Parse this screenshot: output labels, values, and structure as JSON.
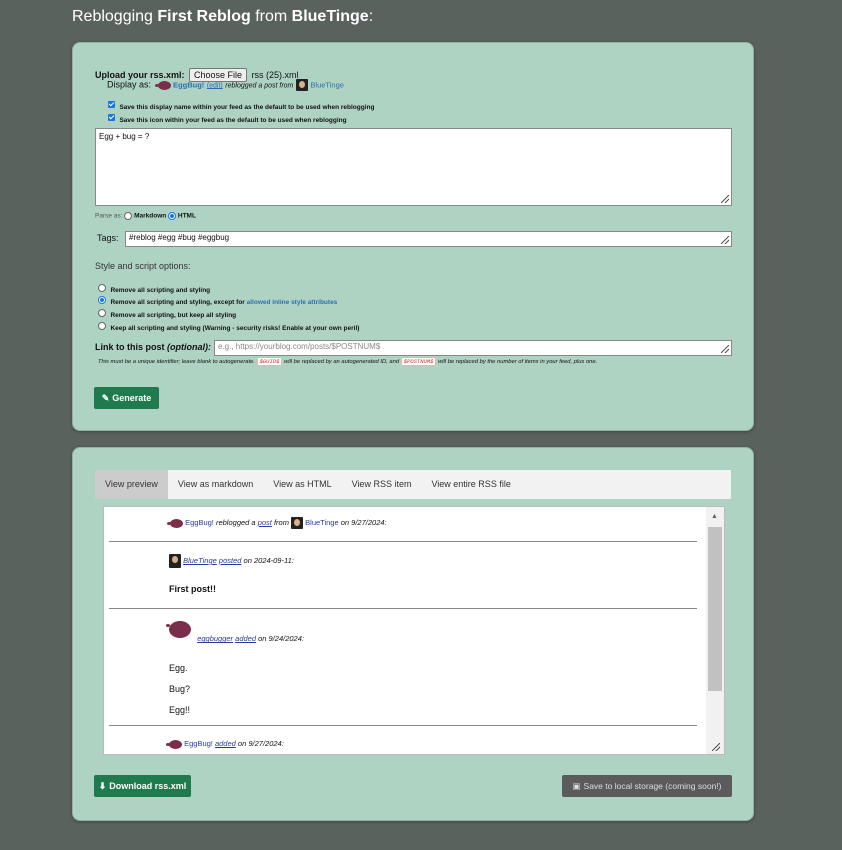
{
  "header": {
    "prefix": "Reblogging ",
    "post_title": "First Reblog",
    "mid": " from ",
    "source_user": "BlueTinge",
    "suffix": ":"
  },
  "upload": {
    "label": "Upload your rss.xml:",
    "button": "Choose File",
    "filename": "rss (25).xml"
  },
  "display": {
    "label": "Display as:",
    "name": "EggBug!",
    "edit": "(edit)",
    "action": "reblogged a post from",
    "from": "BlueTinge"
  },
  "checkboxes": [
    {
      "label": "Save this display name within your feed as the default to be used when reblogging",
      "checked": true
    },
    {
      "label": "Save this icon within your feed as the default to be used when reblogging",
      "checked": true
    }
  ],
  "post_body": "Egg + bug = ?",
  "parse": {
    "label": "Parse as:",
    "options": [
      "Markdown",
      "HTML"
    ],
    "selected": "HTML"
  },
  "tags": {
    "label": "Tags:",
    "value": "#reblog #egg #bug #eggbug"
  },
  "style_options": {
    "heading": "Style and script options:",
    "options": [
      {
        "label": "Remove all scripting and styling"
      },
      {
        "label": "Remove all scripting and styling, except for ",
        "link": "allowed inline style attributes"
      },
      {
        "label": "Remove all scripting, but keep all styling"
      },
      {
        "label": "Keep all scripting and styling (Warning - security risks! Enable at your own peril)"
      }
    ],
    "selected_index": 1
  },
  "link": {
    "label": "Link to this post",
    "optional": "(optional):",
    "placeholder": "e.g., https://yourblog.com/posts/$POSTNUM$",
    "help1": "This must be a unique identifier; leave blank to autogenerate.",
    "code1": "$GUID$",
    "help2": "will be replaced by an autogenerated ID, and",
    "code2": "$POSTNUM$",
    "help3": "will be replaced by the number of items in your feed, plus one."
  },
  "generate_button": "Generate",
  "tabs": [
    "View preview",
    "View as markdown",
    "View as HTML",
    "View RSS item",
    "View entire RSS file"
  ],
  "active_tab": "View preview",
  "preview": {
    "header": {
      "user": "EggBug!",
      "text1": "reblogged a",
      "post": "post",
      "text2": "from",
      "from": "BlueTinge",
      "date": "on 9/27/2024:"
    },
    "entry1": {
      "user": "BlueTinge",
      "action": "posted",
      "date": "on 2024-09-11:",
      "body": "First post!!"
    },
    "entry2": {
      "user": "eggbugger",
      "action": "added",
      "date": "on 9/24/2024:",
      "lines": [
        "Egg.",
        "Bug?",
        "Egg!!"
      ]
    },
    "entry3": {
      "user": "EggBug!",
      "action": "added",
      "date": "on 9/27/2024:"
    }
  },
  "download_button": "Download rss.xml",
  "save_button": "Save to local storage (coming soon!)",
  "colors": {
    "background": "#5a625d",
    "panel": "#aed3c3",
    "primary": "#1f7a4d",
    "disabled": "#5b5b5b"
  }
}
